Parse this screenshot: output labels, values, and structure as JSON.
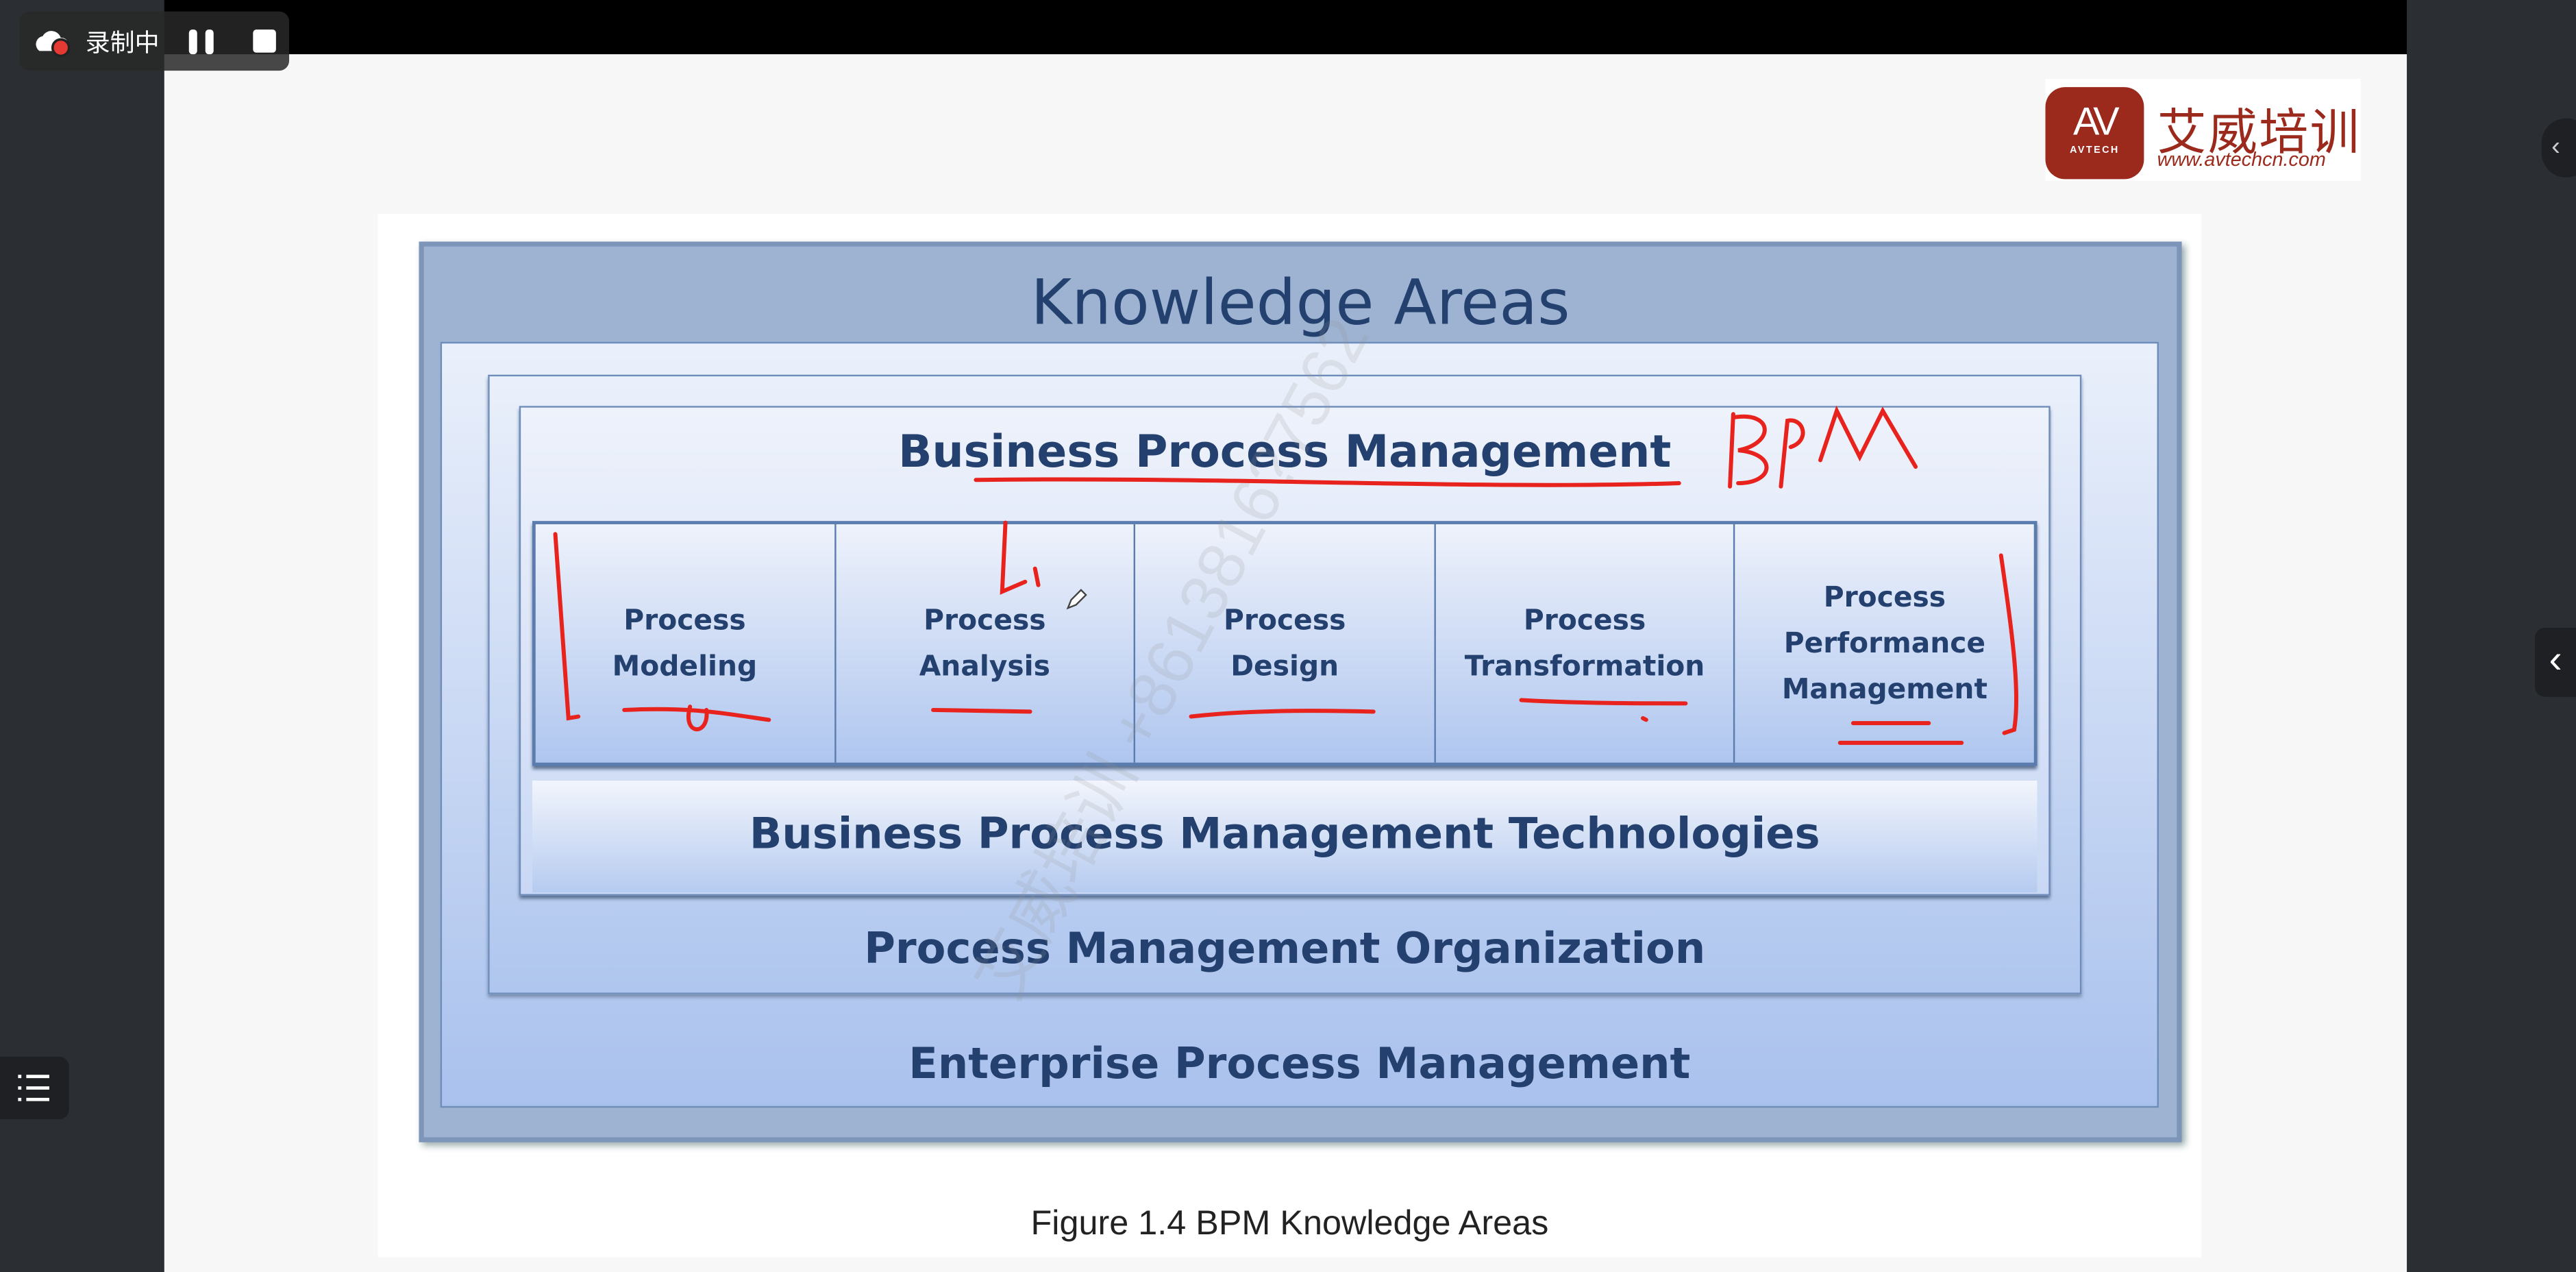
{
  "recorder": {
    "status": "录制中",
    "pause": "pause",
    "stop": "stop"
  },
  "logo": {
    "mark": "AV",
    "sub": "AVTECH",
    "name": "艾威培训",
    "url": "www.avtechcn.com"
  },
  "figure": {
    "title": "Knowledge Areas",
    "bpm": "Business Process Management",
    "cells": [
      {
        "l1": "Process",
        "l2": "Modeling"
      },
      {
        "l1": "Process",
        "l2": "Analysis"
      },
      {
        "l1": "Process",
        "l2": "Design"
      },
      {
        "l1": "Process",
        "l2": "Transformation"
      },
      {
        "l1": "Process",
        "l2": "Performance",
        "l3": "Management"
      }
    ],
    "technologies": "Business Process Management Technologies",
    "organization": "Process Management Organization",
    "enterprise": "Enterprise Process Management",
    "caption": "Figure 1.4 BPM Knowledge Areas"
  },
  "watermark": "艾威培训 +8613816?7562",
  "annotations": {
    "bpm": "BPM",
    "li": "Li"
  },
  "colors": {
    "frame": "#9db3d1",
    "text": "#23406e",
    "ink": "#e8231e",
    "logo": "#9b2a1c"
  }
}
